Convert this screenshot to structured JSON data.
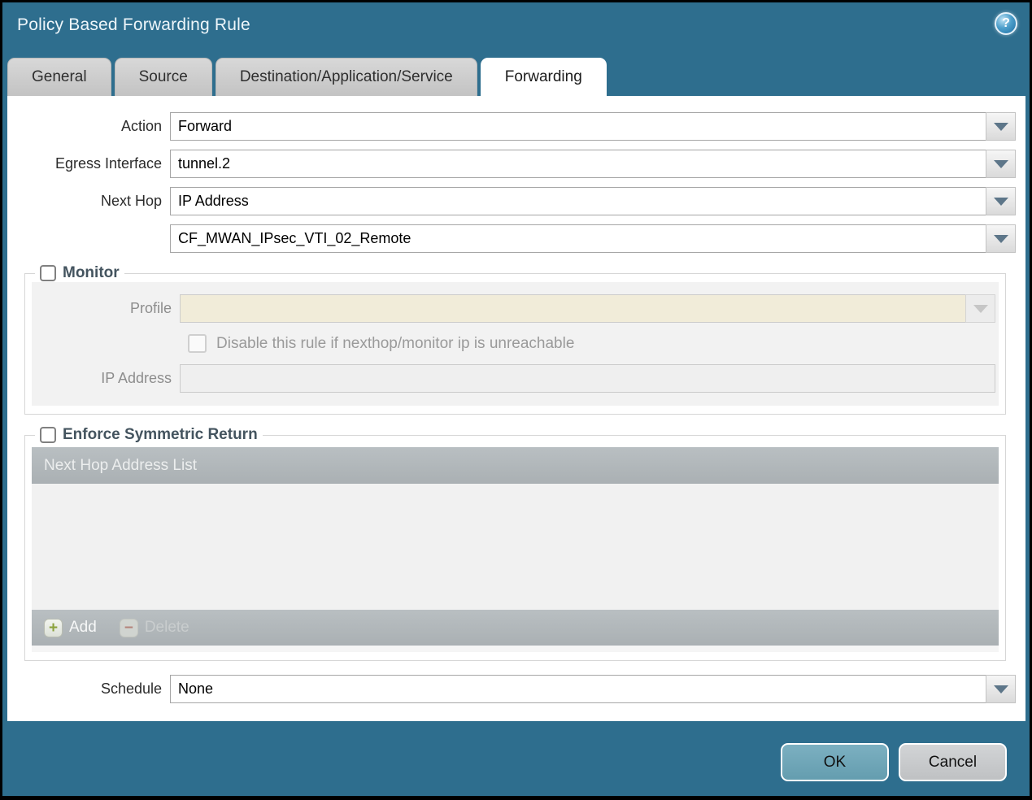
{
  "dialog": {
    "title": "Policy Based Forwarding Rule",
    "help_glyph": "?"
  },
  "tabs": [
    {
      "label": "General",
      "active": false
    },
    {
      "label": "Source",
      "active": false
    },
    {
      "label": "Destination/Application/Service",
      "active": false
    },
    {
      "label": "Forwarding",
      "active": true
    }
  ],
  "form": {
    "action": {
      "label": "Action",
      "value": "Forward"
    },
    "egress_interface": {
      "label": "Egress Interface",
      "value": "tunnel.2"
    },
    "next_hop": {
      "label": "Next Hop",
      "type_value": "IP Address",
      "address_value": "CF_MWAN_IPsec_VTI_02_Remote"
    },
    "schedule": {
      "label": "Schedule",
      "value": "None"
    }
  },
  "monitor": {
    "legend": "Monitor",
    "checked": false,
    "profile_label": "Profile",
    "profile_value": "",
    "disable_checkbox_label": "Disable this rule if nexthop/monitor ip is unreachable",
    "disable_checkbox_checked": false,
    "ip_address_label": "IP Address",
    "ip_address_value": ""
  },
  "symmetric_return": {
    "legend": "Enforce Symmetric Return",
    "checked": false,
    "table_header": "Next Hop Address List",
    "rows": [],
    "add_label": "Add",
    "delete_label": "Delete",
    "add_icon_glyph": "+",
    "delete_icon_glyph": "−"
  },
  "footer": {
    "ok_label": "OK",
    "cancel_label": "Cancel"
  },
  "colors": {
    "frame_teal": "#2e6e8e",
    "active_tab_bg": "#ffffff",
    "inactive_tab_bg": "#c9c9c9",
    "disabled_field_beige": "#f1ecd9",
    "table_bar_gray": "#b1b7ba",
    "ok_button": "#6ca8ba",
    "cancel_button": "#c9cbcd",
    "legend_text": "#44545f",
    "add_plus_green": "#8ba23c",
    "delete_minus_red": "#b5786c"
  }
}
